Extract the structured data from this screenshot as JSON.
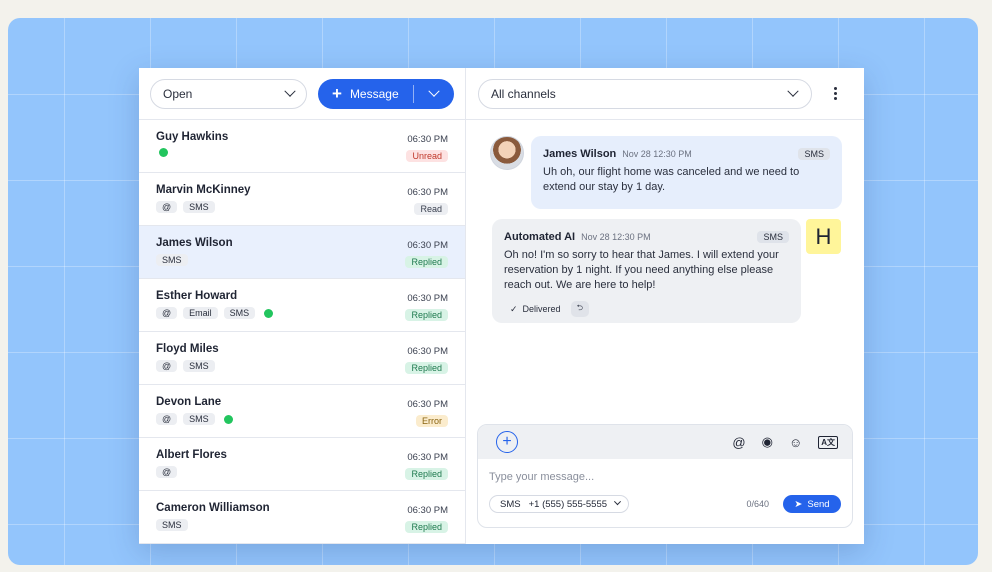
{
  "left": {
    "filter_value": "Open",
    "message_button_label": "Message",
    "conversations": [
      {
        "name": "Guy Hawkins",
        "time": "06:30 PM",
        "status": "Unread",
        "tags": [],
        "whatsapp": true
      },
      {
        "name": "Marvin McKinney",
        "time": "06:30 PM",
        "status": "Read",
        "tags": [
          "@",
          "SMS"
        ],
        "whatsapp": false
      },
      {
        "name": "James Wilson",
        "time": "06:30 PM",
        "status": "Replied",
        "tags": [
          "SMS"
        ],
        "whatsapp": false
      },
      {
        "name": "Esther Howard",
        "time": "06:30 PM",
        "status": "Replied",
        "tags": [
          "@",
          "Email",
          "SMS"
        ],
        "whatsapp": true
      },
      {
        "name": "Floyd Miles",
        "time": "06:30 PM",
        "status": "Replied",
        "tags": [
          "@",
          "SMS"
        ],
        "whatsapp": false
      },
      {
        "name": "Devon Lane",
        "time": "06:30 PM",
        "status": "Error",
        "tags": [
          "@",
          "SMS"
        ],
        "whatsapp": true
      },
      {
        "name": "Albert Flores",
        "time": "06:30 PM",
        "status": "Replied",
        "tags": [
          "@"
        ],
        "whatsapp": false
      },
      {
        "name": "Cameron Williamson",
        "time": "06:30 PM",
        "status": "Replied",
        "tags": [
          "SMS"
        ],
        "whatsapp": false
      }
    ]
  },
  "right": {
    "channel_filter": "All channels",
    "messages": [
      {
        "author": "James Wilson",
        "date": "Nov 28 12:30 PM",
        "channel": "SMS",
        "text": "Uh oh, our flight home was canceled and we need to extend our stay by 1 day."
      },
      {
        "author": "Automated AI",
        "date": "Nov 28 12:30 PM",
        "channel": "SMS",
        "text": "Oh no! I'm so sorry to hear that James. I will extend your reservation by 1 night. If you need anything else please reach out. We are here to help!",
        "delivery": "Delivered"
      }
    ],
    "agent_avatar_letter": "H",
    "composer": {
      "placeholder": "Type your message...",
      "channel": "SMS",
      "phone": "+1 (555) 555-5555",
      "counter": "0/640",
      "send_label": "Send"
    }
  },
  "colors": {
    "accent": "#2563eb",
    "background": "#93c5fc",
    "unread": "#c0392b",
    "replied": "#1f7a4f",
    "error": "#8a6410"
  }
}
